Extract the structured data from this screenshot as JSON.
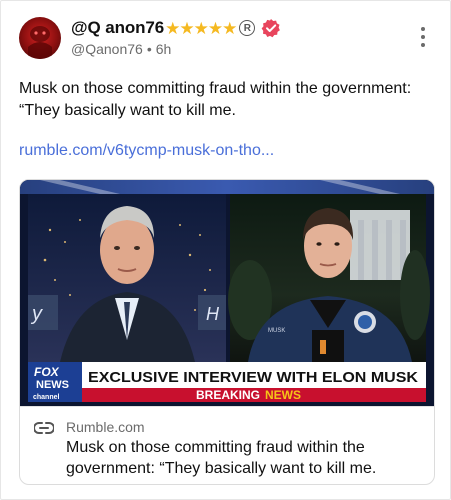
{
  "author": {
    "display_name": "@Q anon76",
    "stars": [
      "★",
      "★",
      "★",
      "★",
      "★"
    ],
    "registered_mark": "R",
    "handle": "@Qanon76",
    "separator": "•",
    "time": "6h"
  },
  "post": {
    "text": "Musk on those committing fraud within the government: “They basically want to kill me.",
    "link_text": "rumble.com/v6tycmp-musk-on-tho..."
  },
  "card": {
    "domain": "Rumble.com",
    "title": "Musk on those committing fraud within the government: “They basically want to kill me.",
    "thumbnail": {
      "network_logo_line1": "FOX",
      "network_logo_line2": "NEWS",
      "network_logo_line3": "channel",
      "headline": "EXCLUSIVE INTERVIEW WITH ELON MUSK",
      "banner_left": "BREAKING",
      "banner_right": "NEWS",
      "left_edge_text": "y",
      "right_edge_text": "H",
      "jacket_patch_text": "MUSK"
    }
  },
  "colors": {
    "star": "#f5b921",
    "verified": "#e8455d",
    "link": "#4a6fd9",
    "chyron_red": "#c8102e",
    "fox_blue": "#1c3f94"
  },
  "icons": {
    "more": "vertical-ellipsis-icon",
    "verified": "verified-badge-icon",
    "link": "chain-link-icon"
  }
}
